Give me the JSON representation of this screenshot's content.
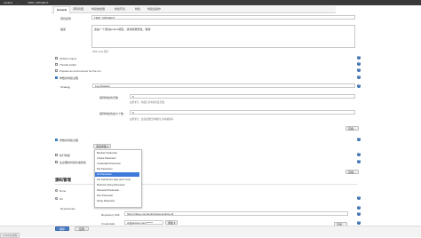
{
  "topbar": {
    "crumbs": [
      "Jenkins",
      "TEST_PROJECT"
    ]
  },
  "tabs": [
    "General",
    "源码管理",
    "构建触发器",
    "构建环境",
    "构建",
    "构建后操作"
  ],
  "general": {
    "project_name_label": "项目名称",
    "project_name_value": "TEST_PROJECT",
    "description_label": "描述",
    "description_value": "这是一个测试jenkins项目，请勿随意修改，谢谢",
    "preview_link": "[Plain text] 预览",
    "options": [
      "GitHub project",
      "Throttle builds",
      "Prepare an environment for the run",
      "参数化构建过程"
    ]
  },
  "param": {
    "strategy_label": "Strategy",
    "strategy_value": "Log Rotation",
    "days_label": "保持构建的天数",
    "days_value": "5",
    "days_hint": "如果非空，构建记录将保存此天数",
    "max_label": "保持构建的最大个数",
    "max_value": "5",
    "max_hint": "如果非空，最多此数目的构建记录将被保存",
    "advanced_button": "高级..."
  },
  "build_params": {
    "label": "参数化构建过程",
    "add_button": "添加参数 ▾",
    "concurrent_label": "执行构建",
    "custom_ws_label": "在必要的时候并发构建",
    "advanced_button": "高级..."
  },
  "dropdown_items": [
    "Boolean Parameter",
    "Choice Parameter",
    "Credentials Parameter",
    "File Parameter",
    "Git Parameter",
    "List Subversion tags (and more)",
    "Multi-line String Parameter",
    "Password Parameter",
    "Run Parameter",
    "String Parameter"
  ],
  "scm": {
    "title": "源码管理",
    "none_label": "None",
    "git_label": "Git",
    "repos_label": "Repositories",
    "repo_url_label": "Repository URL",
    "repo_url_value": "https://gitee.com/jenkins/test-jenkins.git",
    "credentials_label": "Credentials",
    "credentials_value": "ci@jenkins.com/******",
    "add_button": "添加 ▾",
    "advanced_button": "高级..."
  },
  "footer": {
    "save": "保存",
    "apply": "应用"
  },
  "statusbar": "CSDN@博客"
}
